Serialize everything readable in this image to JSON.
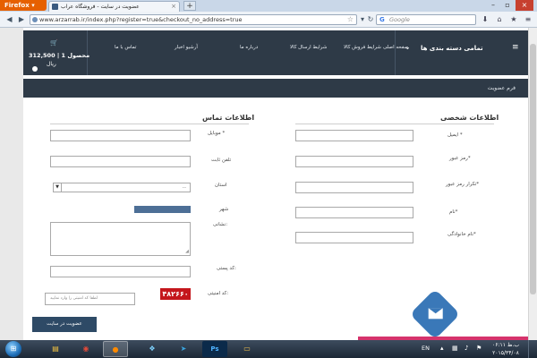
{
  "browser": {
    "menu_button": "Firefox",
    "tab_title": "عضویت در سایت - فروشگاه عراب",
    "new_tab_glyph": "+",
    "url": "www.arzarrab.ir/index.php?register=true&checkout_no_address=true",
    "search_placeholder": "Google",
    "search_engine_glyph": "G"
  },
  "site": {
    "cart": {
      "count_label": "1 محصول",
      "price": "312,500",
      "currency": "ریال"
    },
    "menu": [
      "تماس با ما",
      "آرشیو اخبار",
      "درباره ما",
      "شرایط ارسال کالا",
      "شرایط فروش کالا",
      "صفحه اصلی"
    ],
    "category_title": "تمامی دسته بندی ها",
    "breadcrumb": "فرم عضویت"
  },
  "form": {
    "personal_title": "اطلاعات شخصی",
    "contact_title": "اطلاعات تماس",
    "labels": {
      "email": "ایمیل *",
      "password": "رمز عبور*",
      "password_repeat": "تکرار رمز عبور*",
      "first_name": "نام*",
      "last_name": "نام خانوادگی*",
      "mobile": "موبایل *",
      "phone": "تلفن ثابت",
      "province": "استان",
      "city": "شهر",
      "address": "نشانی:",
      "postal_code": "کد پستی:",
      "captcha": "کد امنیتی:"
    },
    "province_selected": "--",
    "captcha_value": "۴۸۲۶۶۰",
    "captcha_placeholder": "لطفا کد امنیتی را وارد نمایید",
    "submit_label": "عضویت در سایت"
  },
  "taskbar": {
    "language": "EN",
    "clock_time": "۰۶:۱۱ ب.ظ",
    "clock_date": "۲۰۱۵/۳۴/۰۸"
  },
  "colors": {
    "header_bg": "#2e3a47",
    "firefox_orange": "#e66000",
    "captcha_red": "#c4161c",
    "submit_blue": "#2e4a66",
    "fab_blue": "#3a78b8"
  }
}
